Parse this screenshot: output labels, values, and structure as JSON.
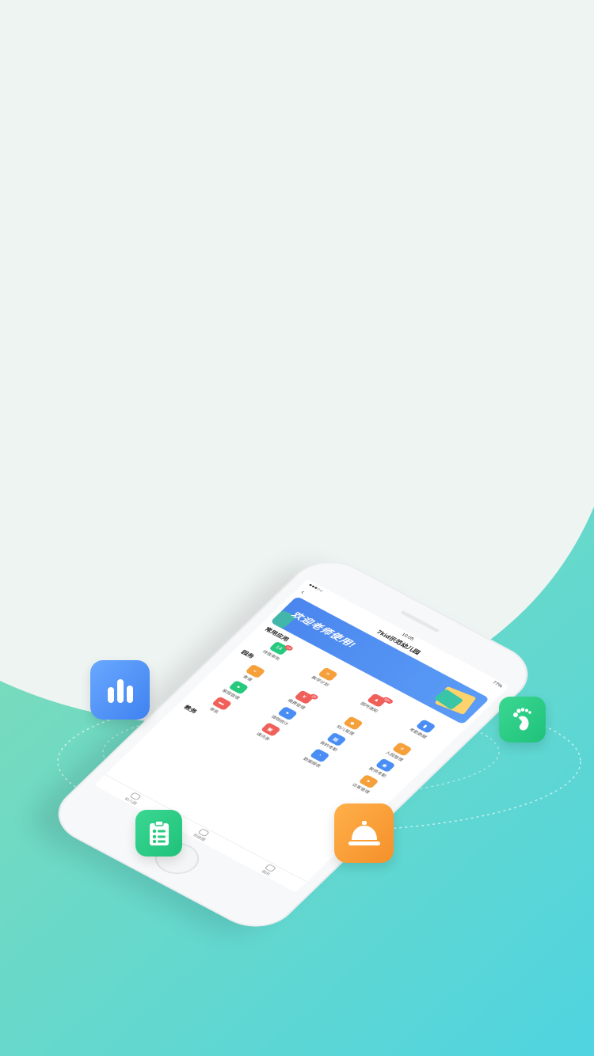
{
  "colors": {
    "background_top": "#eef4f2",
    "wave_start": "#7fdcb6",
    "wave_end": "#4fd4e0",
    "blue": "#4a8ef5",
    "green": "#26c97e",
    "orange": "#f5a03a",
    "red": "#f0605a"
  },
  "floating_icons": [
    {
      "name": "bar-chart-icon",
      "color": "#4a8ef5"
    },
    {
      "name": "footprint-icon",
      "color": "#26c97e"
    },
    {
      "name": "clipboard-checklist-icon",
      "color": "#26c97e"
    },
    {
      "name": "service-bell-icon",
      "color": "#f5a03a"
    }
  ],
  "phone": {
    "status": {
      "signal": "●●●○○",
      "time": "10:05",
      "battery": "77%"
    },
    "nav": {
      "back": "‹",
      "title": "7kid示范幼儿园"
    },
    "banner": {
      "text": "欢迎老师使用!"
    },
    "sections": {
      "common": "常用应用",
      "affairs": "园务",
      "teaching": "教务"
    },
    "common_apps": [
      {
        "label": "待我审批",
        "icon": "14",
        "badge": "14",
        "color": "#26c97e"
      },
      {
        "label": "教学计划",
        "icon": "≡",
        "badge": "",
        "color": "#f5a03a"
      },
      {
        "label": "园所通知",
        "icon": "▲",
        "badge": "99+",
        "color": "#f0605a"
      },
      {
        "label": "考勤数据",
        "icon": "▮",
        "badge": "",
        "color": "#4a8ef5"
      }
    ],
    "affairs_apps": [
      {
        "label": "食谱",
        "icon": "◒",
        "badge": "",
        "color": "#f5a03a"
      },
      {
        "label": "缴费管理",
        "icon": "¥",
        "badge": "20",
        "color": "#f0605a"
      },
      {
        "label": "幼儿管理",
        "icon": "◆",
        "badge": "",
        "color": "#f5a03a"
      },
      {
        "label": "入园管理",
        "icon": "≡",
        "badge": "",
        "color": "#f5a03a"
      },
      {
        "label": "家园管理",
        "icon": "●",
        "badge": "",
        "color": "#26c97e"
      },
      {
        "label": "请假统计",
        "icon": "●",
        "badge": "",
        "color": "#4a8ef5"
      },
      {
        "label": "我的考勤",
        "icon": "▦",
        "badge": "",
        "color": "#4a8ef5"
      },
      {
        "label": "教师考勤",
        "icon": "◉",
        "badge": "",
        "color": "#4a8ef5"
      },
      {
        "label": "审批",
        "icon": "▬",
        "badge": "",
        "color": "#f0605a"
      },
      {
        "label": "通讯录",
        "icon": "▣",
        "badge": "",
        "color": "#f0605a"
      },
      {
        "label": "数据报表",
        "icon": "◔",
        "badge": "",
        "color": "#4a8ef5"
      },
      {
        "label": "访客管理",
        "icon": "●",
        "badge": "",
        "color": "#f5a03a"
      }
    ],
    "tabs": [
      {
        "label": "幼儿园"
      },
      {
        "label": "班级圈"
      },
      {
        "label": "我的"
      }
    ]
  }
}
